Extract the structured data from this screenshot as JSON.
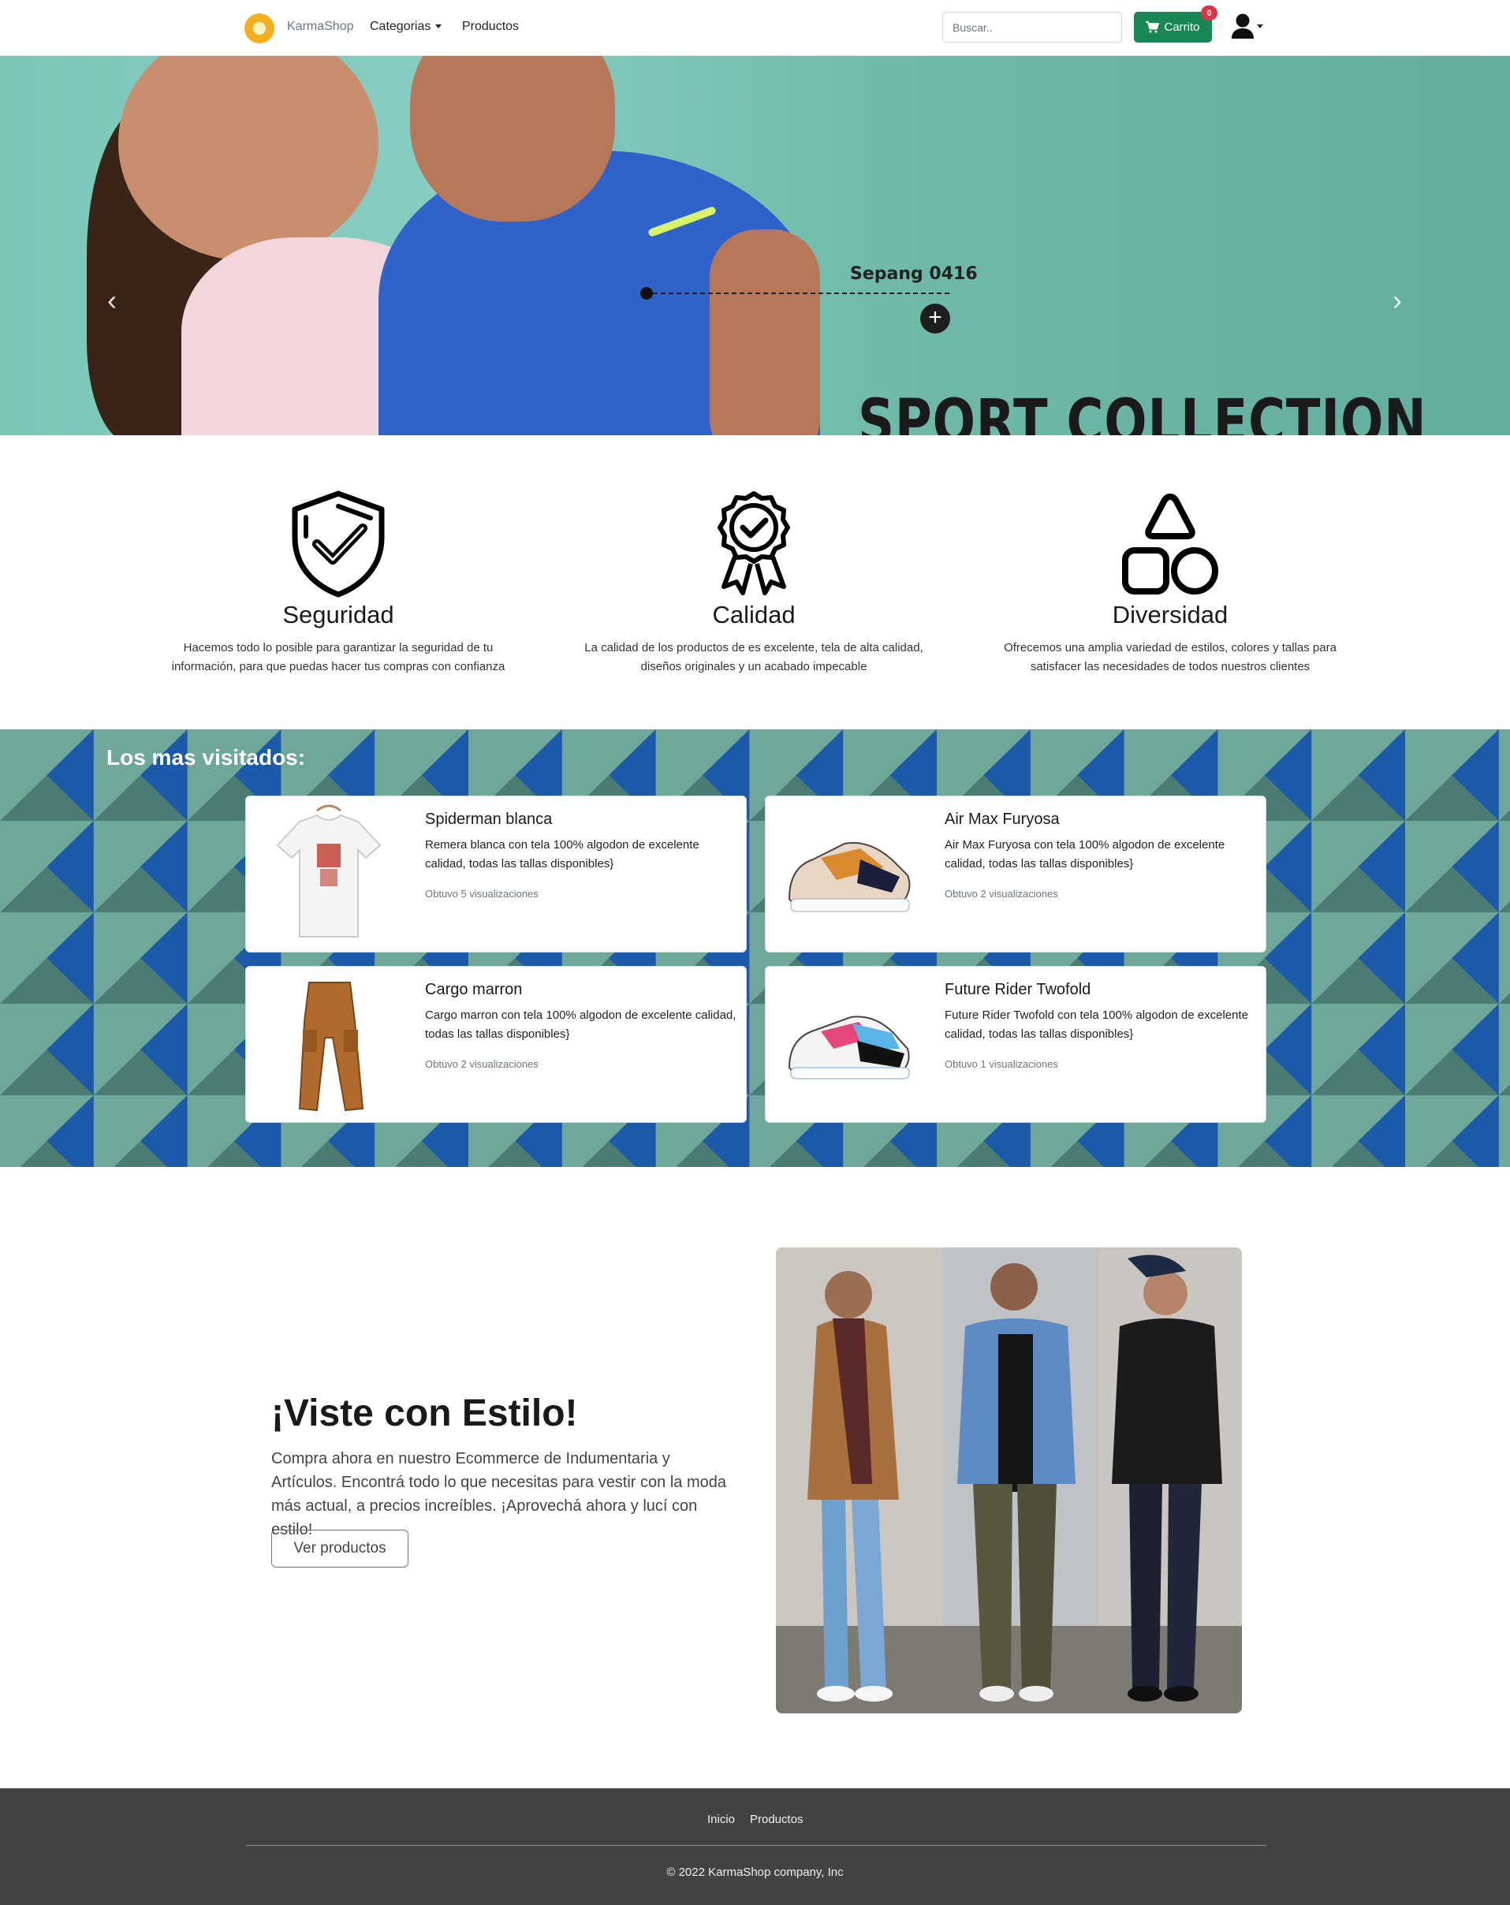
{
  "navbar": {
    "brand": "KarmaShop",
    "links": [
      {
        "label": "Categorias"
      },
      {
        "label": "Productos"
      }
    ],
    "search_placeholder": "Buscar..",
    "cart_label": "Carrito",
    "cart_count": "0"
  },
  "hero": {
    "tag": "Sepang 0416",
    "title": "SPORT COLLECTION",
    "plus": "+",
    "prev": "‹",
    "next": "›"
  },
  "features": [
    {
      "icon": "shield-check-icon",
      "title": "Seguridad",
      "text": "Hacemos todo lo posible para garantizar la seguridad de tu información, para que puedas hacer tus compras con confianza"
    },
    {
      "icon": "award-badge-icon",
      "title": "Calidad",
      "text": "La calidad de los productos de es excelente, tela de alta calidad, diseños originales y un acabado impecable"
    },
    {
      "icon": "shapes-icon",
      "title": "Diversidad",
      "text": "Ofrecemos una amplia variedad de estilos, colores y tallas para satisfacer las necesidades de todos nuestros clientes"
    }
  ],
  "most_visited": {
    "title": "Los mas visitados:",
    "products": [
      {
        "name": "Spiderman blanca",
        "description": "Remera blanca con tela 100% algodon de excelente calidad, todas las tallas disponibles}",
        "views": "Obtuvo 5 visualizaciones"
      },
      {
        "name": "Air Max Furyosa",
        "description": "Air Max Furyosa con tela 100% algodon de excelente calidad, todas las tallas disponibles}",
        "views": "Obtuvo 2 visualizaciones"
      },
      {
        "name": "Cargo marron",
        "description": "Cargo marron con tela 100% algodon de excelente calidad, todas las tallas disponibles}",
        "views": "Obtuvo 2 visualizaciones"
      },
      {
        "name": "Future Rider Twofold",
        "description": "Future Rider Twofold con tela 100% algodon de excelente calidad, todas las tallas disponibles}",
        "views": "Obtuvo 1 visualizaciones"
      }
    ]
  },
  "promo": {
    "title": "¡Viste con Estilo!",
    "text": "Compra ahora en nuestro Ecommerce de Indumentaria y Artículos. Encontrá todo lo que necesitas para vestir con la moda más actual, a precios increíbles. ¡Aprovechá ahora y lucí con estilo!",
    "button": "Ver productos"
  },
  "footer": {
    "links": [
      {
        "label": "Inicio"
      },
      {
        "label": "Productos"
      }
    ],
    "copyright": "© 2022 KarmaShop company, Inc"
  },
  "colors": {
    "brand_yellow": "#f2b01e",
    "cart_green": "#198754",
    "badge_red": "#dc3545",
    "pattern_dark": "#4a7c74",
    "pattern_light": "#6fa89a",
    "pattern_blue": "#1b5aa8",
    "footer_bg": "#434343"
  }
}
